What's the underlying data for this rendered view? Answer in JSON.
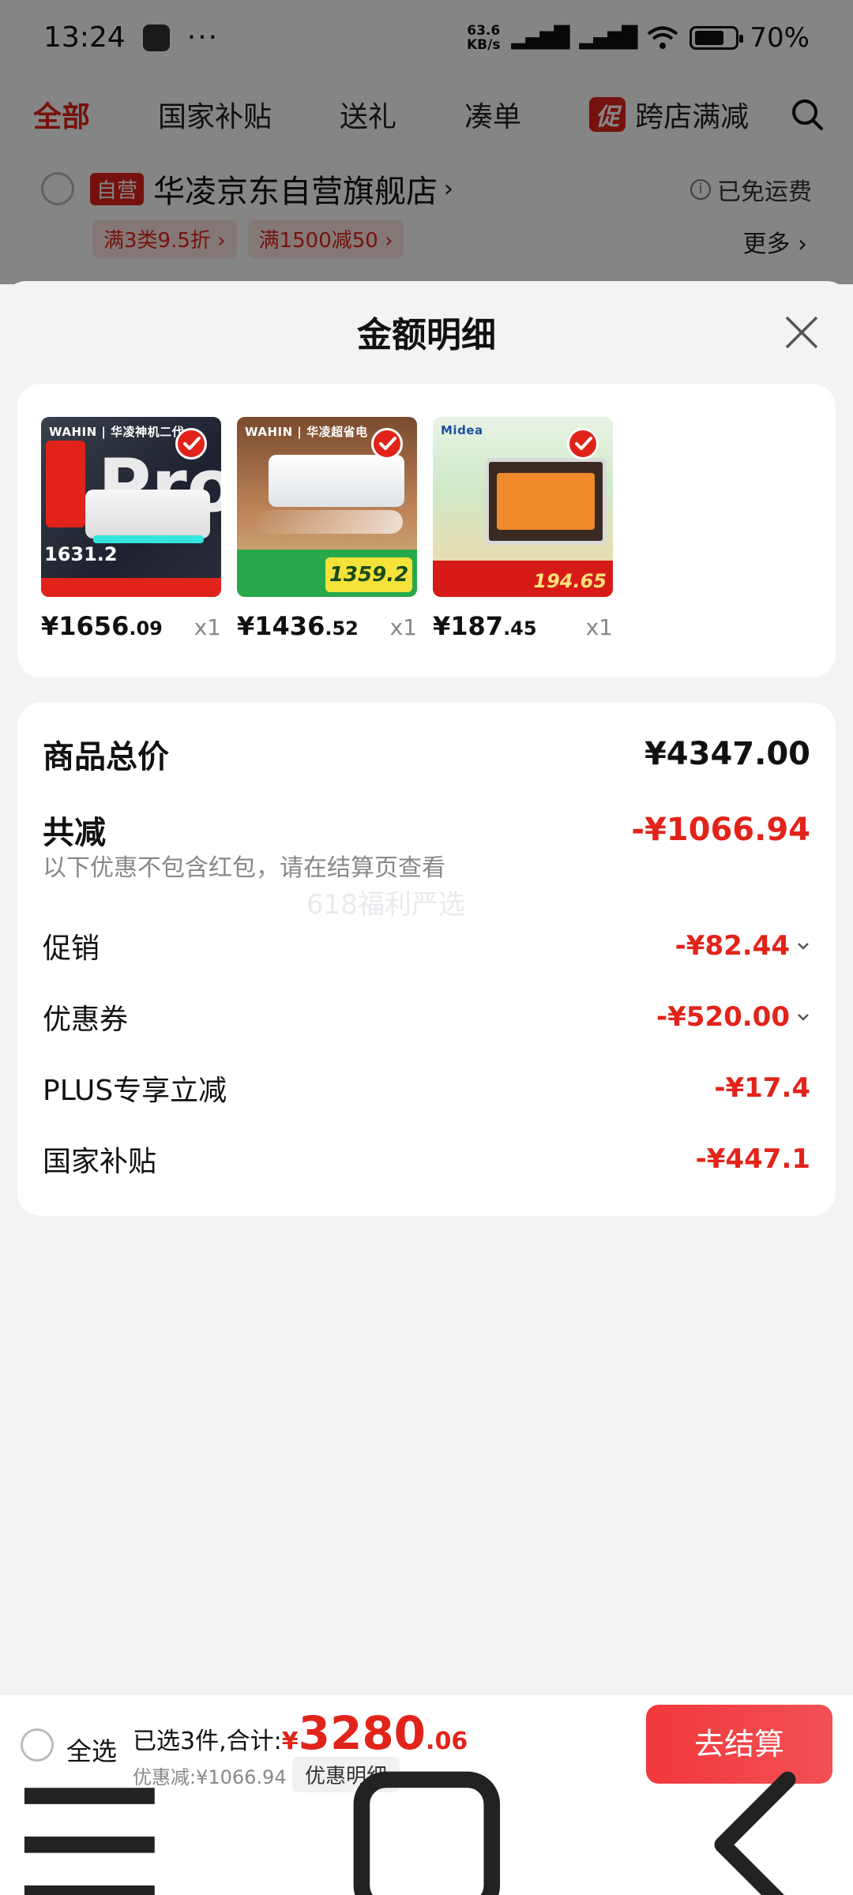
{
  "status_bar": {
    "time": "13:24",
    "net_speed_top": "63.6",
    "net_speed_bottom": "KB/s",
    "signal": "HD",
    "battery": "70%"
  },
  "tabs": [
    {
      "label": "全部",
      "active": true
    },
    {
      "label": "国家补贴"
    },
    {
      "label": "送礼"
    },
    {
      "label": "凑单"
    }
  ],
  "promo_tab": {
    "badge": "促",
    "label": "跨店满减"
  },
  "store": {
    "badge": "自营",
    "name": "华凌京东自营旗舰店",
    "shipping": "已免运费",
    "promos": [
      "满3类9.5折 ›",
      "满1500减50 ›"
    ],
    "more": "更多 ›"
  },
  "sheet": {
    "title": "金额明细",
    "products": [
      {
        "brand": "WAHIN | 华凌神机二代",
        "price_int": "¥1656",
        "price_dec": ".09",
        "qty": "x1",
        "thumb_text": "Pro",
        "thumb_num": "1631.2"
      },
      {
        "brand": "WAHIN | 华凌超省电",
        "price_int": "¥1436",
        "price_dec": ".52",
        "qty": "x1",
        "thumb_text": "1359.2"
      },
      {
        "brand": "Midea",
        "price_int": "¥187",
        "price_dec": ".45",
        "qty": "x1",
        "thumb_text": "194.65"
      }
    ],
    "total_label": "商品总价",
    "total_value": "¥4347.00",
    "reduce_label": "共减",
    "reduce_value": "-¥1066.94",
    "note": "以下优惠不包含红包，请在结算页查看",
    "watermark": "618福利严选",
    "lines": [
      {
        "label": "促销",
        "value": "-¥82.44",
        "expand": true
      },
      {
        "label": "优惠券",
        "value": "-¥520.00",
        "expand": true
      },
      {
        "label": "PLUS专享立减",
        "value": "-¥17.4",
        "expand": false
      },
      {
        "label": "国家补贴",
        "value": "-¥447.1",
        "expand": false
      }
    ]
  },
  "bottom_bar": {
    "select_all": "全选",
    "summary_prefix": "已选3件,合计:",
    "yen": "¥",
    "total_int": "3280",
    "total_dec": ".06",
    "discount": "优惠减:¥1066.94",
    "detail_button": "优惠明细",
    "checkout": "去结算"
  },
  "colors": {
    "accent": "#e2231a",
    "checkout": "#f2383b"
  }
}
